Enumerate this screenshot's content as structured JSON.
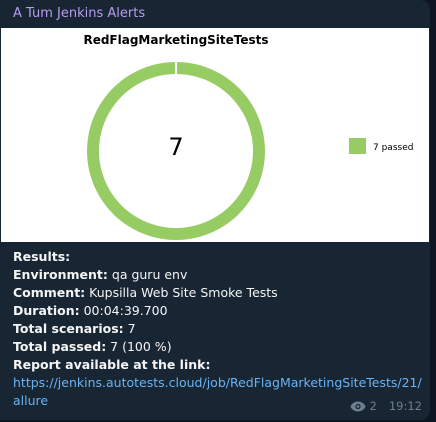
{
  "sender": "A Tum Jenkins Alerts",
  "chart_data": {
    "type": "pie",
    "title": "RedFlagMarketingSiteTests",
    "center_label": "7",
    "series": [
      {
        "name": "passed",
        "value": 7,
        "color": "#97cc64"
      }
    ],
    "legend": [
      {
        "label": "7 passed",
        "color": "#97cc64"
      }
    ],
    "legend_position": "right"
  },
  "message": {
    "results_label": "Results:",
    "environment_label": "Environment:",
    "environment_value": " qa guru env",
    "comment_label": "Comment:",
    "comment_value": " Kupsilla Web Site Smoke Tests",
    "duration_label": "Duration:",
    "duration_value": " 00:04:39.700",
    "total_scenarios_label": "Total scenarios:",
    "total_scenarios_value": " 7",
    "total_passed_label": "Total passed:",
    "total_passed_value": " 7 (100 %)",
    "report_label": "Report available at the link:",
    "report_link": "https://jenkins.autotests.cloud/job/RedFlagMarketingSiteTests/21/allure"
  },
  "meta": {
    "views": "2",
    "time": "19:12",
    "views_icon": "eye-icon"
  }
}
